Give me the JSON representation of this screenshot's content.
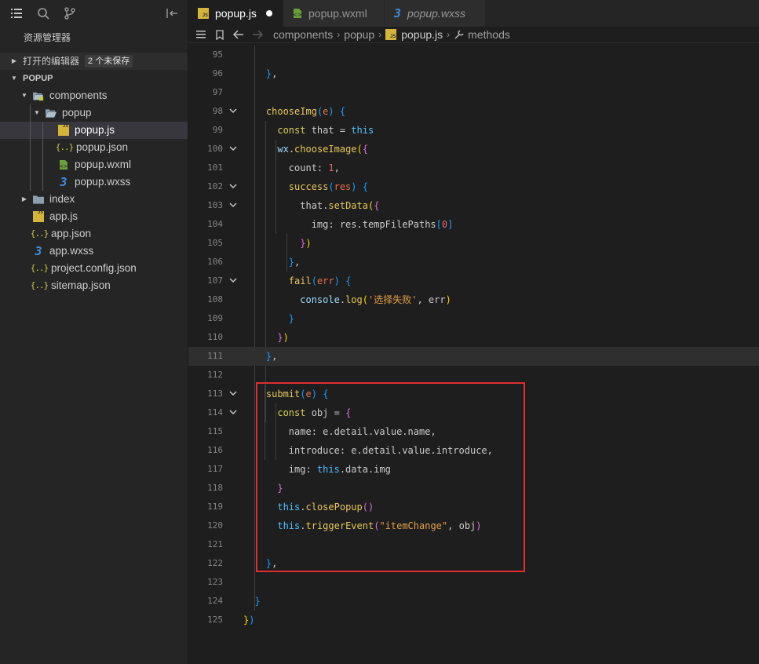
{
  "sidebar": {
    "title": "资源管理器",
    "open_editors": {
      "label": "打开的编辑器",
      "badge": "2 个未保存"
    },
    "project": {
      "label": "POPUP"
    },
    "tree": [
      {
        "label": "components",
        "kind": "folder-open",
        "depth": 0,
        "twisty": "open"
      },
      {
        "label": "popup",
        "kind": "folder-open-plain",
        "depth": 1,
        "twisty": "open"
      },
      {
        "label": "popup.js",
        "kind": "js",
        "depth": 2,
        "selected": true
      },
      {
        "label": "popup.json",
        "kind": "json",
        "depth": 2
      },
      {
        "label": "popup.wxml",
        "kind": "wxml",
        "depth": 2
      },
      {
        "label": "popup.wxss",
        "kind": "wxss",
        "depth": 2
      },
      {
        "label": "index",
        "kind": "folder",
        "depth": 0,
        "twisty": "closed"
      },
      {
        "label": "app.js",
        "kind": "js",
        "depth": 0
      },
      {
        "label": "app.json",
        "kind": "json",
        "depth": 0
      },
      {
        "label": "app.wxss",
        "kind": "wxss",
        "depth": 0
      },
      {
        "label": "project.config.json",
        "kind": "json",
        "depth": 0
      },
      {
        "label": "sitemap.json",
        "kind": "json",
        "depth": 0
      }
    ]
  },
  "tabs": [
    {
      "label": "popup.js",
      "kind": "js",
      "active": true,
      "unsaved": true
    },
    {
      "label": "popup.wxml",
      "kind": "wxml",
      "active": false,
      "unsaved": true
    },
    {
      "label": "popup.wxss",
      "kind": "wxss",
      "active": false,
      "unsaved": false,
      "italic": true
    }
  ],
  "breadcrumb": {
    "parts": [
      "components",
      "popup",
      "popup.js",
      "methods"
    ]
  },
  "editor": {
    "lines": [
      {
        "n": "95",
        "t": []
      },
      {
        "n": "96",
        "t": [
          [
            "    ",
            "v"
          ],
          [
            "}",
            "b3"
          ],
          [
            ",",
            "p"
          ]
        ]
      },
      {
        "n": "97",
        "t": []
      },
      {
        "n": "98",
        "fold": true,
        "t": [
          [
            "    ",
            "v"
          ],
          [
            "chooseImg",
            "fn"
          ],
          [
            "(",
            "b3"
          ],
          [
            "e",
            "par"
          ],
          [
            ")",
            "b3"
          ],
          [
            " ",
            "v"
          ],
          [
            "{",
            "b3"
          ]
        ]
      },
      {
        "n": "99",
        "t": [
          [
            "      ",
            "v"
          ],
          [
            "const",
            "kw"
          ],
          [
            " that = ",
            "v"
          ],
          [
            "this",
            "th"
          ]
        ]
      },
      {
        "n": "100",
        "fold": true,
        "t": [
          [
            "      ",
            "v"
          ],
          [
            "wx",
            "wx"
          ],
          [
            ".",
            "p"
          ],
          [
            "chooseImage",
            "fn"
          ],
          [
            "(",
            "b1"
          ],
          [
            "{",
            "b2"
          ]
        ]
      },
      {
        "n": "101",
        "t": [
          [
            "        ",
            "v"
          ],
          [
            "count",
            "v"
          ],
          [
            ": ",
            "p"
          ],
          [
            "1",
            "n"
          ],
          [
            ",",
            "p"
          ]
        ]
      },
      {
        "n": "102",
        "fold": true,
        "t": [
          [
            "        ",
            "v"
          ],
          [
            "success",
            "fn"
          ],
          [
            "(",
            "b3"
          ],
          [
            "res",
            "par"
          ],
          [
            ")",
            "b3"
          ],
          [
            " ",
            "v"
          ],
          [
            "{",
            "b3"
          ]
        ]
      },
      {
        "n": "103",
        "fold": true,
        "t": [
          [
            "          ",
            "v"
          ],
          [
            "that",
            "v"
          ],
          [
            ".",
            "p"
          ],
          [
            "setData",
            "fn"
          ],
          [
            "(",
            "b1"
          ],
          [
            "{",
            "b2"
          ]
        ]
      },
      {
        "n": "104",
        "t": [
          [
            "            ",
            "v"
          ],
          [
            "img: res.tempFilePaths",
            "v"
          ],
          [
            "[",
            "b3"
          ],
          [
            "0",
            "n"
          ],
          [
            "]",
            "b3"
          ]
        ]
      },
      {
        "n": "105",
        "t": [
          [
            "          ",
            "v"
          ],
          [
            "}",
            "b2"
          ],
          [
            ")",
            "b1"
          ]
        ]
      },
      {
        "n": "106",
        "t": [
          [
            "        ",
            "v"
          ],
          [
            "}",
            "b3"
          ],
          [
            ",",
            "p"
          ]
        ]
      },
      {
        "n": "107",
        "fold": true,
        "t": [
          [
            "        ",
            "v"
          ],
          [
            "fail",
            "fn"
          ],
          [
            "(",
            "b3"
          ],
          [
            "err",
            "par"
          ],
          [
            ")",
            "b3"
          ],
          [
            " ",
            "v"
          ],
          [
            "{",
            "b3"
          ]
        ]
      },
      {
        "n": "108",
        "t": [
          [
            "          ",
            "v"
          ],
          [
            "console",
            "wx"
          ],
          [
            ".",
            "p"
          ],
          [
            "log",
            "fn"
          ],
          [
            "(",
            "b1"
          ],
          [
            "'选择失败'",
            "s"
          ],
          [
            ", err",
            "v"
          ],
          [
            ")",
            "b1"
          ]
        ]
      },
      {
        "n": "109",
        "t": [
          [
            "        ",
            "v"
          ],
          [
            "}",
            "b3"
          ]
        ]
      },
      {
        "n": "110",
        "t": [
          [
            "      ",
            "v"
          ],
          [
            "}",
            "b2"
          ],
          [
            ")",
            "b1"
          ]
        ]
      },
      {
        "n": "111",
        "hl": true,
        "t": [
          [
            "    ",
            "v"
          ],
          [
            "}",
            "b3"
          ],
          [
            ",",
            "p"
          ]
        ]
      },
      {
        "n": "112",
        "t": []
      },
      {
        "n": "113",
        "fold": true,
        "t": [
          [
            "    ",
            "v"
          ],
          [
            "submit",
            "fn"
          ],
          [
            "(",
            "b3"
          ],
          [
            "e",
            "par"
          ],
          [
            ")",
            "b3"
          ],
          [
            " ",
            "v"
          ],
          [
            "{",
            "b3"
          ]
        ]
      },
      {
        "n": "114",
        "fold": true,
        "t": [
          [
            "      ",
            "v"
          ],
          [
            "const",
            "kw"
          ],
          [
            " obj = ",
            "v"
          ],
          [
            "{",
            "b2"
          ]
        ]
      },
      {
        "n": "115",
        "t": [
          [
            "        ",
            "v"
          ],
          [
            "name: e.detail.value.name,",
            "v"
          ]
        ]
      },
      {
        "n": "116",
        "t": [
          [
            "        ",
            "v"
          ],
          [
            "introduce: e.detail.value.introduce,",
            "v"
          ]
        ]
      },
      {
        "n": "117",
        "t": [
          [
            "        ",
            "v"
          ],
          [
            "img: ",
            "v"
          ],
          [
            "this",
            "th"
          ],
          [
            ".data.img",
            "v"
          ]
        ]
      },
      {
        "n": "118",
        "t": [
          [
            "      ",
            "v"
          ],
          [
            "}",
            "b2"
          ]
        ]
      },
      {
        "n": "119",
        "t": [
          [
            "      ",
            "v"
          ],
          [
            "this",
            "th"
          ],
          [
            ".",
            "p"
          ],
          [
            "closePopup",
            "fn"
          ],
          [
            "(",
            "b2"
          ],
          [
            ")",
            "b2"
          ]
        ]
      },
      {
        "n": "120",
        "t": [
          [
            "      ",
            "v"
          ],
          [
            "this",
            "th"
          ],
          [
            ".",
            "p"
          ],
          [
            "triggerEvent",
            "fn"
          ],
          [
            "(",
            "b2"
          ],
          [
            "\"itemChange\"",
            "s"
          ],
          [
            ", obj",
            "v"
          ],
          [
            ")",
            "b2"
          ]
        ]
      },
      {
        "n": "121",
        "t": []
      },
      {
        "n": "122",
        "t": [
          [
            "    ",
            "v"
          ],
          [
            "}",
            "b3"
          ],
          [
            ",",
            "p"
          ]
        ]
      },
      {
        "n": "123",
        "t": []
      },
      {
        "n": "124",
        "t": [
          [
            "  ",
            "v"
          ],
          [
            "}",
            "b3"
          ]
        ]
      },
      {
        "n": "125",
        "t": [
          [
            "}",
            "b1"
          ],
          [
            ")",
            "b3"
          ]
        ]
      }
    ]
  },
  "colors": {
    "highlight_box": "#e12d2d",
    "accent": "#3e8ede"
  }
}
